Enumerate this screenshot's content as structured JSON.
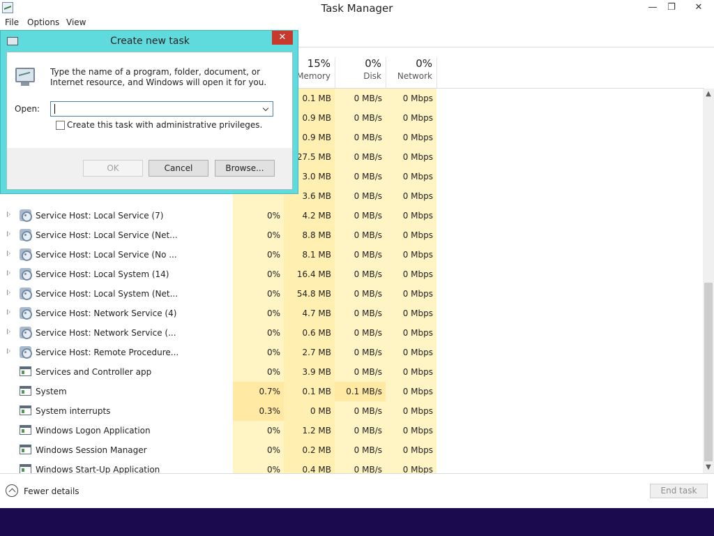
{
  "window": {
    "title": "Task Manager",
    "minimize_glyph": "—",
    "maximize_glyph": "❐",
    "close_glyph": "✕"
  },
  "menu": [
    "File",
    "Options",
    "View"
  ],
  "columns": {
    "memory": {
      "percent": "15%",
      "name": "Memory"
    },
    "disk": {
      "percent": "0%",
      "name": "Disk"
    },
    "network": {
      "percent": "0%",
      "name": "Network"
    }
  },
  "rows_partial": [
    {
      "memory": "0.1 MB",
      "disk": "0 MB/s",
      "network": "0 Mbps"
    },
    {
      "memory": "0.9 MB",
      "disk": "0 MB/s",
      "network": "0 Mbps"
    },
    {
      "memory": "0.9 MB",
      "disk": "0 MB/s",
      "network": "0 Mbps"
    },
    {
      "memory": "27.5 MB",
      "disk": "0 MB/s",
      "network": "0 Mbps"
    },
    {
      "memory": "3.0 MB",
      "disk": "0 MB/s",
      "network": "0 Mbps"
    },
    {
      "memory": "3.6 MB",
      "disk": "0 MB/s",
      "network": "0 Mbps"
    }
  ],
  "rows": [
    {
      "name": "Service Host: Local Service (7)",
      "icon": "gear-icon",
      "expandable": true,
      "cpu": "0%",
      "memory": "4.2 MB",
      "disk": "0 MB/s",
      "network": "0 Mbps"
    },
    {
      "name": "Service Host: Local Service (Net...",
      "icon": "gear-icon",
      "expandable": true,
      "cpu": "0%",
      "memory": "8.8 MB",
      "disk": "0 MB/s",
      "network": "0 Mbps"
    },
    {
      "name": "Service Host: Local Service (No ...",
      "icon": "gear-icon",
      "expandable": true,
      "cpu": "0%",
      "memory": "8.1 MB",
      "disk": "0 MB/s",
      "network": "0 Mbps"
    },
    {
      "name": "Service Host: Local System (14)",
      "icon": "gear-icon",
      "expandable": true,
      "cpu": "0%",
      "memory": "16.4 MB",
      "disk": "0 MB/s",
      "network": "0 Mbps"
    },
    {
      "name": "Service Host: Local System (Net...",
      "icon": "gear-icon",
      "expandable": true,
      "cpu": "0%",
      "memory": "54.8 MB",
      "disk": "0 MB/s",
      "network": "0 Mbps"
    },
    {
      "name": "Service Host: Network Service (4)",
      "icon": "gear-icon",
      "expandable": true,
      "cpu": "0%",
      "memory": "4.7 MB",
      "disk": "0 MB/s",
      "network": "0 Mbps"
    },
    {
      "name": "Service Host: Network Service (...",
      "icon": "gear-icon",
      "expandable": true,
      "cpu": "0%",
      "memory": "0.6 MB",
      "disk": "0 MB/s",
      "network": "0 Mbps"
    },
    {
      "name": "Service Host: Remote Procedure...",
      "icon": "gear-icon",
      "expandable": true,
      "cpu": "0%",
      "memory": "2.7 MB",
      "disk": "0 MB/s",
      "network": "0 Mbps"
    },
    {
      "name": "Services and Controller app",
      "icon": "app-icon",
      "expandable": false,
      "cpu": "0%",
      "memory": "3.9 MB",
      "disk": "0 MB/s",
      "network": "0 Mbps"
    },
    {
      "name": "System",
      "icon": "app-icon",
      "expandable": false,
      "cpu": "0.7%",
      "memory": "0.1 MB",
      "disk": "0.1 MB/s",
      "network": "0 Mbps"
    },
    {
      "name": "System interrupts",
      "icon": "app-icon",
      "expandable": false,
      "cpu": "0.3%",
      "memory": "0 MB",
      "disk": "0 MB/s",
      "network": "0 Mbps"
    },
    {
      "name": "Windows Logon Application",
      "icon": "app-icon",
      "expandable": false,
      "cpu": "0%",
      "memory": "1.2 MB",
      "disk": "0 MB/s",
      "network": "0 Mbps"
    },
    {
      "name": "Windows Session Manager",
      "icon": "app-icon",
      "expandable": false,
      "cpu": "0%",
      "memory": "0.2 MB",
      "disk": "0 MB/s",
      "network": "0 Mbps"
    },
    {
      "name": "Windows Start-Up Application",
      "icon": "app-icon",
      "expandable": false,
      "cpu": "0%",
      "memory": "0.4 MB",
      "disk": "0 MB/s",
      "network": "0 Mbps"
    }
  ],
  "footer": {
    "fewer_details": "Fewer details",
    "end_task": "End task"
  },
  "dialog": {
    "title": "Create new task",
    "close_glyph": "✕",
    "description": "Type the name of a program, folder, document, or Internet resource, and Windows will open it for you.",
    "open_label": "Open:",
    "open_value": "",
    "admin_label": "Create this task with administrative privileges.",
    "admin_checked": false,
    "ok": "OK",
    "cancel": "Cancel",
    "browse": "Browse..."
  },
  "colors": {
    "highlight_light": "#fff4c4",
    "highlight_mid": "#ffefb0",
    "dialog_frame": "#5fdadd",
    "dialog_close": "#c7382d",
    "taskbar": "#1c0a4e"
  },
  "scrollbar": {
    "up_glyph": "▲",
    "down_glyph": "▼"
  }
}
